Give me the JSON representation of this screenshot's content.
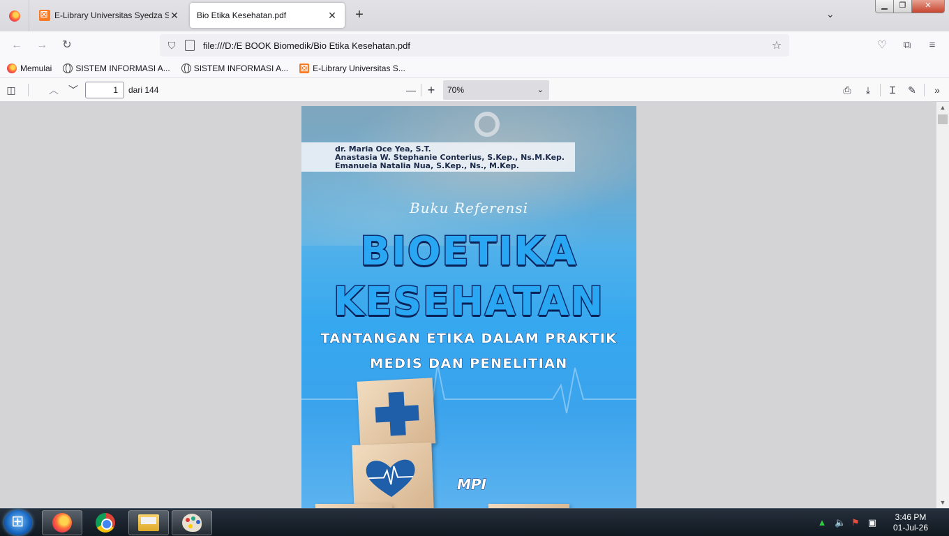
{
  "browser": {
    "tabs": [
      {
        "title": "E-Library Universitas Syedza Saintika",
        "active": false
      },
      {
        "title": "Bio Etika Kesehatan.pdf",
        "active": true
      }
    ],
    "new_tab_label": "+",
    "url": "file:///D:/E BOOK Biomedik/Bio Etika Kesehatan.pdf"
  },
  "bookmarks": [
    {
      "label": "Memulai",
      "icon": "firefox-icon"
    },
    {
      "label": "SISTEM INFORMASI A...",
      "icon": "globe-icon"
    },
    {
      "label": "SISTEM INFORMASI A...",
      "icon": "globe-icon"
    },
    {
      "label": "E-Library Universitas S...",
      "icon": "xampp-icon"
    }
  ],
  "pdf_toolbar": {
    "page_number": "1",
    "page_total": "dari 144",
    "zoom": "70%"
  },
  "cover": {
    "authors": [
      "dr. Maria Oce Yea, S.T.",
      "Anastasia W. Stephanie Conterius, S.Kep., Ns.M.Kep.",
      "Emanuela Natalia Nua, S.Kep., Ns., M.Kep."
    ],
    "series": "Buku Referensi",
    "title_line1": "BIOETIKA",
    "title_line2": "KESEHATAN",
    "subtitle_line1": "TANTANGAN ETIKA DALAM PRAKTIK",
    "subtitle_line2": "MEDIS DAN PENELITIAN",
    "publisher_logo": "MPI"
  },
  "taskbar": {
    "time": "3:46 PM",
    "date": "01-Jul-26"
  },
  "colors": {
    "cover_blue": "#35a8f0",
    "title_fill": "#2aa7f2",
    "title_outline": "#0d2e6e",
    "window_close": "#c7452f"
  }
}
